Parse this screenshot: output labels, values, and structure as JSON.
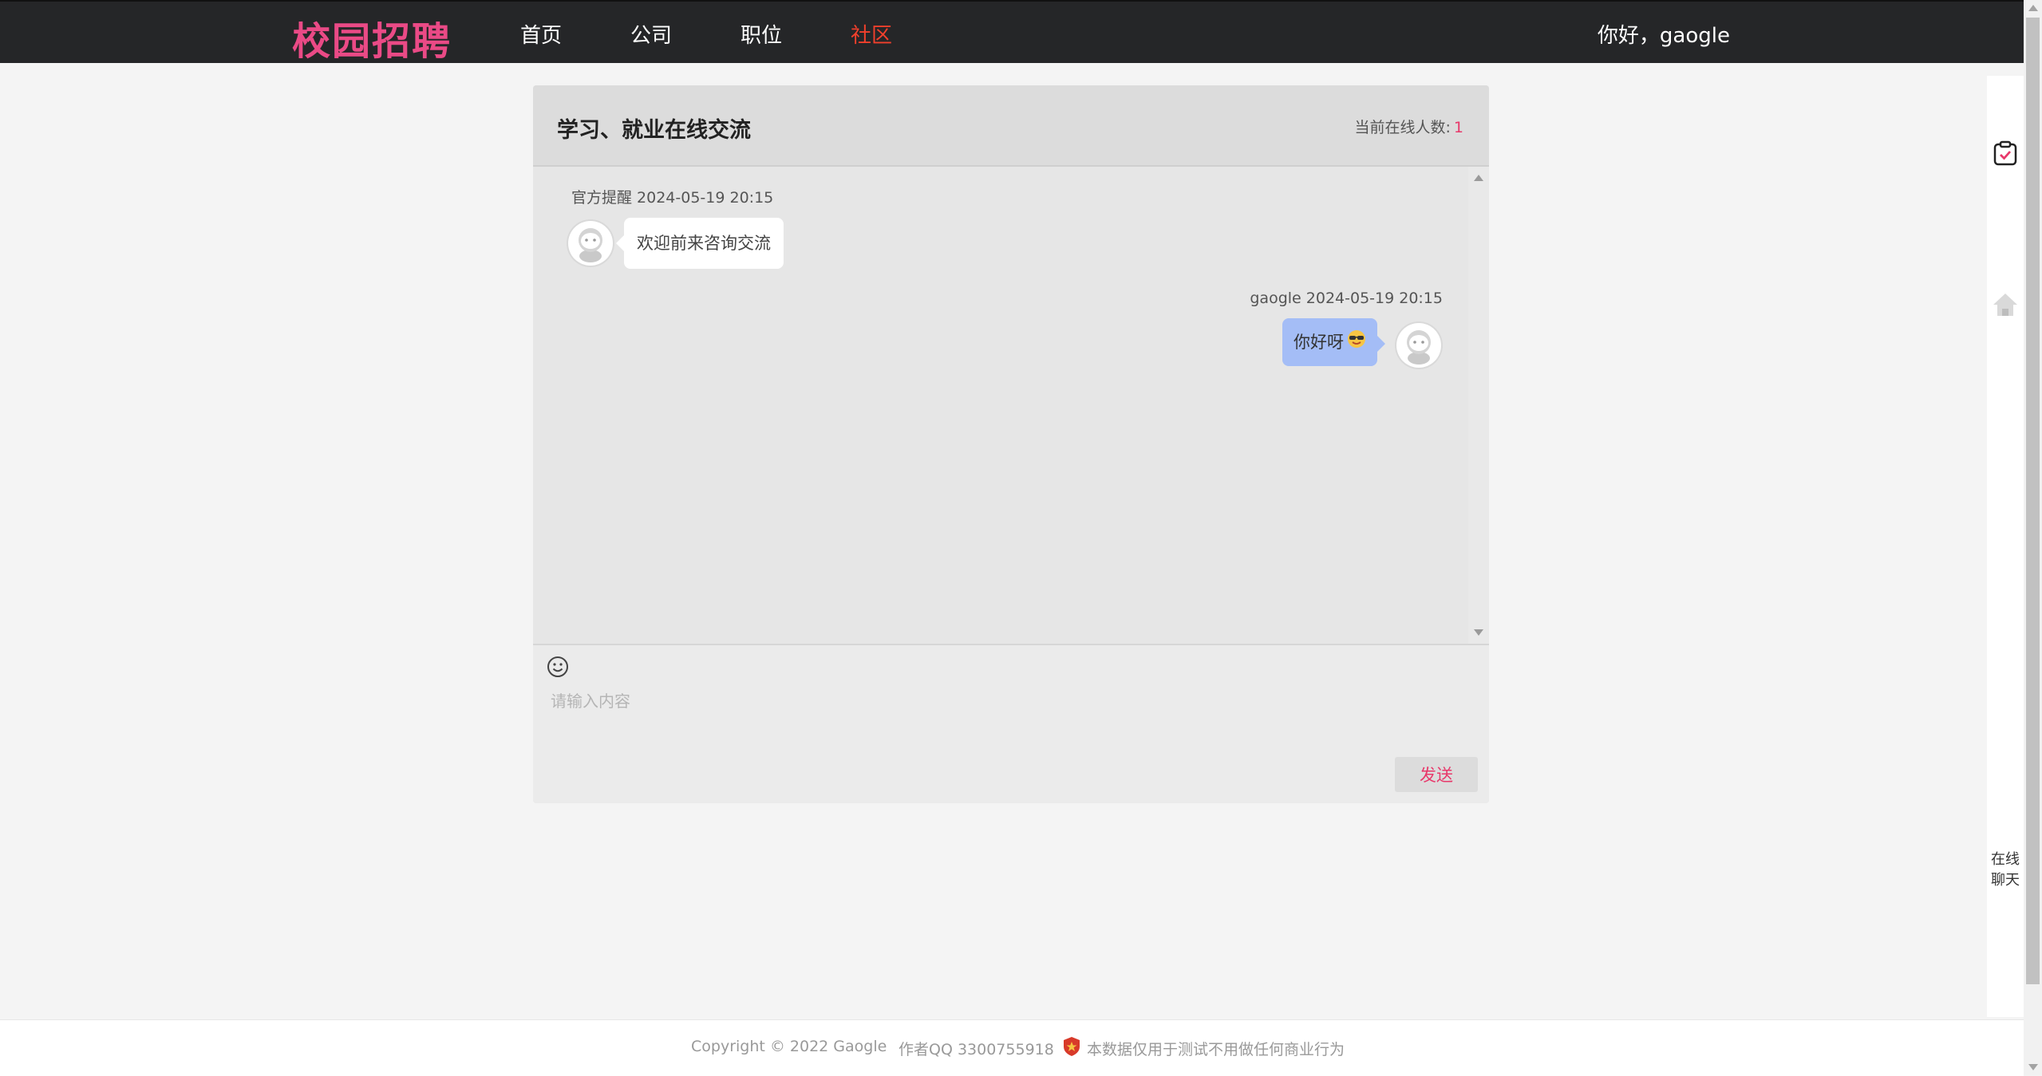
{
  "header": {
    "logo": "校园招聘",
    "nav": [
      {
        "label": "首页",
        "active": false
      },
      {
        "label": "公司",
        "active": false
      },
      {
        "label": "职位",
        "active": false
      },
      {
        "label": "社区",
        "active": true
      }
    ],
    "greeting": "你好，gaogle"
  },
  "chat": {
    "title": "学习、就业在线交流",
    "online_label": "当前在线人数:",
    "online_count": "1",
    "messages": [
      {
        "sender": "官方提醒",
        "time": "2024-05-19 20:15",
        "meta": "官方提醒 2024-05-19 20:15",
        "text": "欢迎前来咨询交流",
        "side": "left"
      },
      {
        "sender": "gaogle",
        "time": "2024-05-19 20:15",
        "meta": "gaogle 2024-05-19 20:15",
        "text": "你好呀",
        "emoji": "sunglasses-emoji",
        "side": "right"
      }
    ],
    "input_placeholder": "请输入内容",
    "send_label": "发送"
  },
  "sidebar": {
    "icons": [
      "clipboard-check-icon",
      "home-icon"
    ],
    "chat_label_line1": "在线",
    "chat_label_line2": "聊天"
  },
  "footer": {
    "copyright": "Copyright © 2022 Gaogle",
    "author": "作者QQ 3300755918",
    "notice": "本数据仅用于测试不用做任何商业行为"
  },
  "colors": {
    "brand": "#ea4a86",
    "nav_active": "#f2402c",
    "topbar_bg": "#252628",
    "own_bubble": "#a4bdf6",
    "accent": "#e8386a"
  }
}
